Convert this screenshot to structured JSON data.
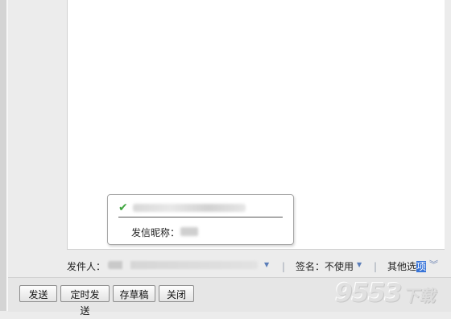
{
  "editor": {},
  "popup": {
    "checkmark": "✔",
    "email_hint": "blurred-email",
    "nickname_label": "发信昵称：",
    "nickname_hint": "blurred-nickname"
  },
  "sender": {
    "label": "发件人：",
    "value_hint": "blurred-sender",
    "separator": "|",
    "signature_label": "签名：",
    "signature_value": "不使用",
    "other_options_prefix": "其他选",
    "other_options_selected": "项",
    "chevron": "≫"
  },
  "toolbar": {
    "send_label": "发送",
    "timed_send_label": "定时发送",
    "save_draft_label": "存草稿",
    "close_label": "关闭"
  },
  "watermark": {
    "number": "9553",
    "suffix": "下载"
  },
  "colors": {
    "check": "#3fa63f",
    "dropdown_arrow": "#5a7db8",
    "selection": "#3874d8"
  }
}
